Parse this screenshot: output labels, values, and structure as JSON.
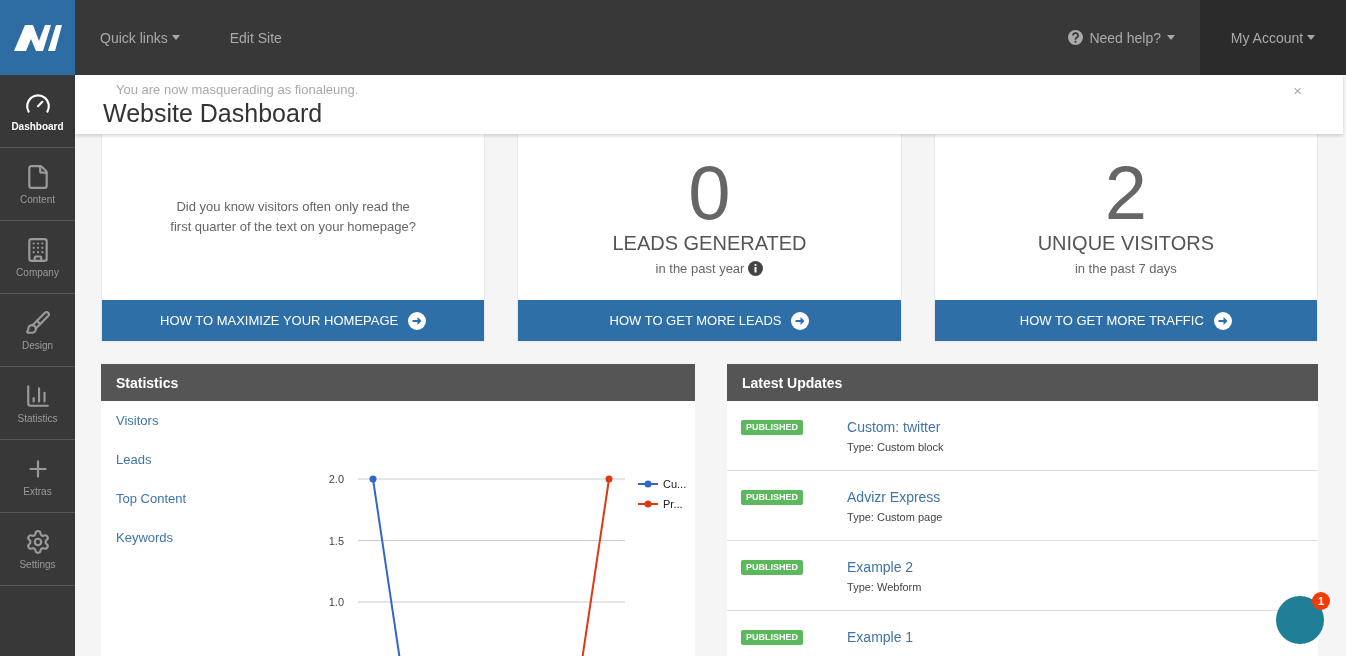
{
  "topbar": {
    "nav": [
      {
        "label": "Quick links",
        "dropdown": true
      },
      {
        "label": "Edit Site",
        "dropdown": false
      }
    ],
    "help": "Need help?",
    "account": "My Account"
  },
  "sidebar": {
    "items": [
      {
        "label": "Dashboard",
        "selected": true
      },
      {
        "label": "Content",
        "selected": false
      },
      {
        "label": "Company",
        "selected": false
      },
      {
        "label": "Design",
        "selected": false
      },
      {
        "label": "Statistics",
        "selected": false
      },
      {
        "label": "Extras",
        "selected": false
      },
      {
        "label": "Settings",
        "selected": false
      }
    ]
  },
  "notice": {
    "text": "You are now masquerading as fionaleung.",
    "close": "×"
  },
  "page_title": "Website Dashboard",
  "cards": [
    {
      "kind": "tip",
      "text": "Did you know visitors often only read the first quarter of the text on your homepage?",
      "button": "HOW TO MAXIMIZE YOUR HOMEPAGE"
    },
    {
      "kind": "metric",
      "value": "0",
      "title": "LEADS GENERATED",
      "subtitle": "in the past year",
      "info": true,
      "button": "HOW TO GET MORE LEADS"
    },
    {
      "kind": "metric",
      "value": "2",
      "title": "UNIQUE VISITORS",
      "subtitle": "in the past 7 days",
      "info": false,
      "button": "HOW TO GET MORE TRAFFIC"
    }
  ],
  "statistics": {
    "title": "Statistics",
    "links": [
      "Visitors",
      "Leads",
      "Top Content",
      "Keywords"
    ],
    "chart": {
      "y_labels": [
        "2.0",
        "1.5",
        "1.0"
      ],
      "legend": [
        {
          "name": "Cu...",
          "color": "#3366cc"
        },
        {
          "name": "Pr...",
          "color": "#dc3912"
        }
      ]
    }
  },
  "updates": {
    "title": "Latest Updates",
    "items": [
      {
        "status": "PUBLISHED",
        "title": "Custom: twitter",
        "type": "Type: Custom block"
      },
      {
        "status": "PUBLISHED",
        "title": "Advizr Express",
        "type": "Type: Custom page"
      },
      {
        "status": "PUBLISHED",
        "title": "Example 2",
        "type": "Type: Webform"
      },
      {
        "status": "PUBLISHED",
        "title": "Example 1"
      }
    ]
  },
  "chat": {
    "badge": "1"
  }
}
